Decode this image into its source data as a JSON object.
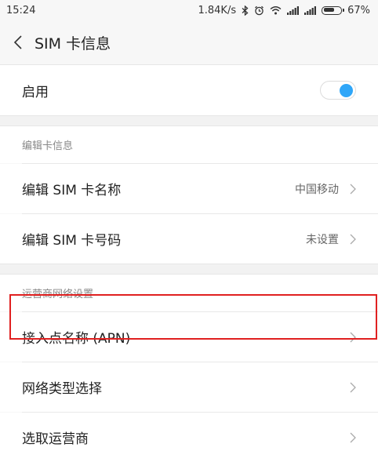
{
  "status_bar": {
    "time": "15:24",
    "net_speed": "1.84K/s",
    "battery": "67%",
    "battery_level": 0.67,
    "icons": [
      "bluetooth-icon",
      "alarm-icon",
      "wifi-icon",
      "signal-icon",
      "signal-icon",
      "battery-icon"
    ]
  },
  "header": {
    "title": "SIM 卡信息",
    "back_icon": "back-arrow-icon"
  },
  "enable": {
    "label": "启用",
    "enabled": true,
    "toggle_color": "#2fa6f8"
  },
  "sim_section": {
    "label": "编辑卡信息",
    "items": [
      {
        "label": "编辑 SIM 卡名称",
        "value": "中国移动"
      },
      {
        "label": "编辑 SIM 卡号码",
        "value": "未设置"
      }
    ]
  },
  "carrier_section": {
    "label": "运营商网络设置",
    "items": [
      {
        "label": "接入点名称 (APN)",
        "value": "",
        "highlighted": true
      },
      {
        "label": "网络类型选择",
        "value": ""
      },
      {
        "label": "选取运营商",
        "value": ""
      }
    ]
  },
  "highlight_color": "#e02020"
}
